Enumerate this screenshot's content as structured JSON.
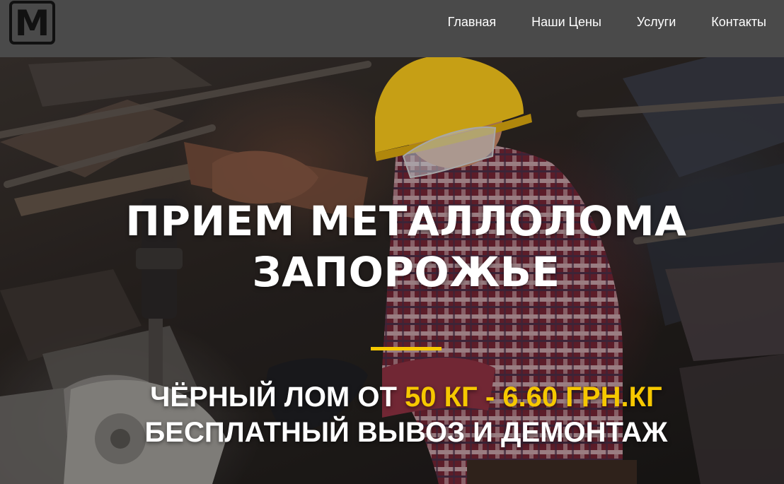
{
  "header": {
    "logo_letter": "M",
    "nav": [
      {
        "label": "Главная"
      },
      {
        "label": "Наши Цены"
      },
      {
        "label": "Услуги"
      },
      {
        "label": "Контакты"
      }
    ]
  },
  "hero": {
    "title_line1": "ПРИЕМ МЕТАЛЛОЛОМА",
    "title_line2": "ЗАПОРОЖЬЕ",
    "sub_line1_prefix": "ЧЁРНЫЙ ЛОМ ОТ ",
    "sub_line1_highlight": "50 КГ - 6.60 ГРН.КГ",
    "sub_line2": "БЕСПЛАТНЫЙ ВЫВОЗ И ДЕМОНТАЖ"
  },
  "colors": {
    "navbar_bg": "#4a4a4a",
    "accent_yellow": "#f6c800",
    "text_white": "#ffffff"
  },
  "icons": {
    "logo": "logo-m-icon"
  }
}
